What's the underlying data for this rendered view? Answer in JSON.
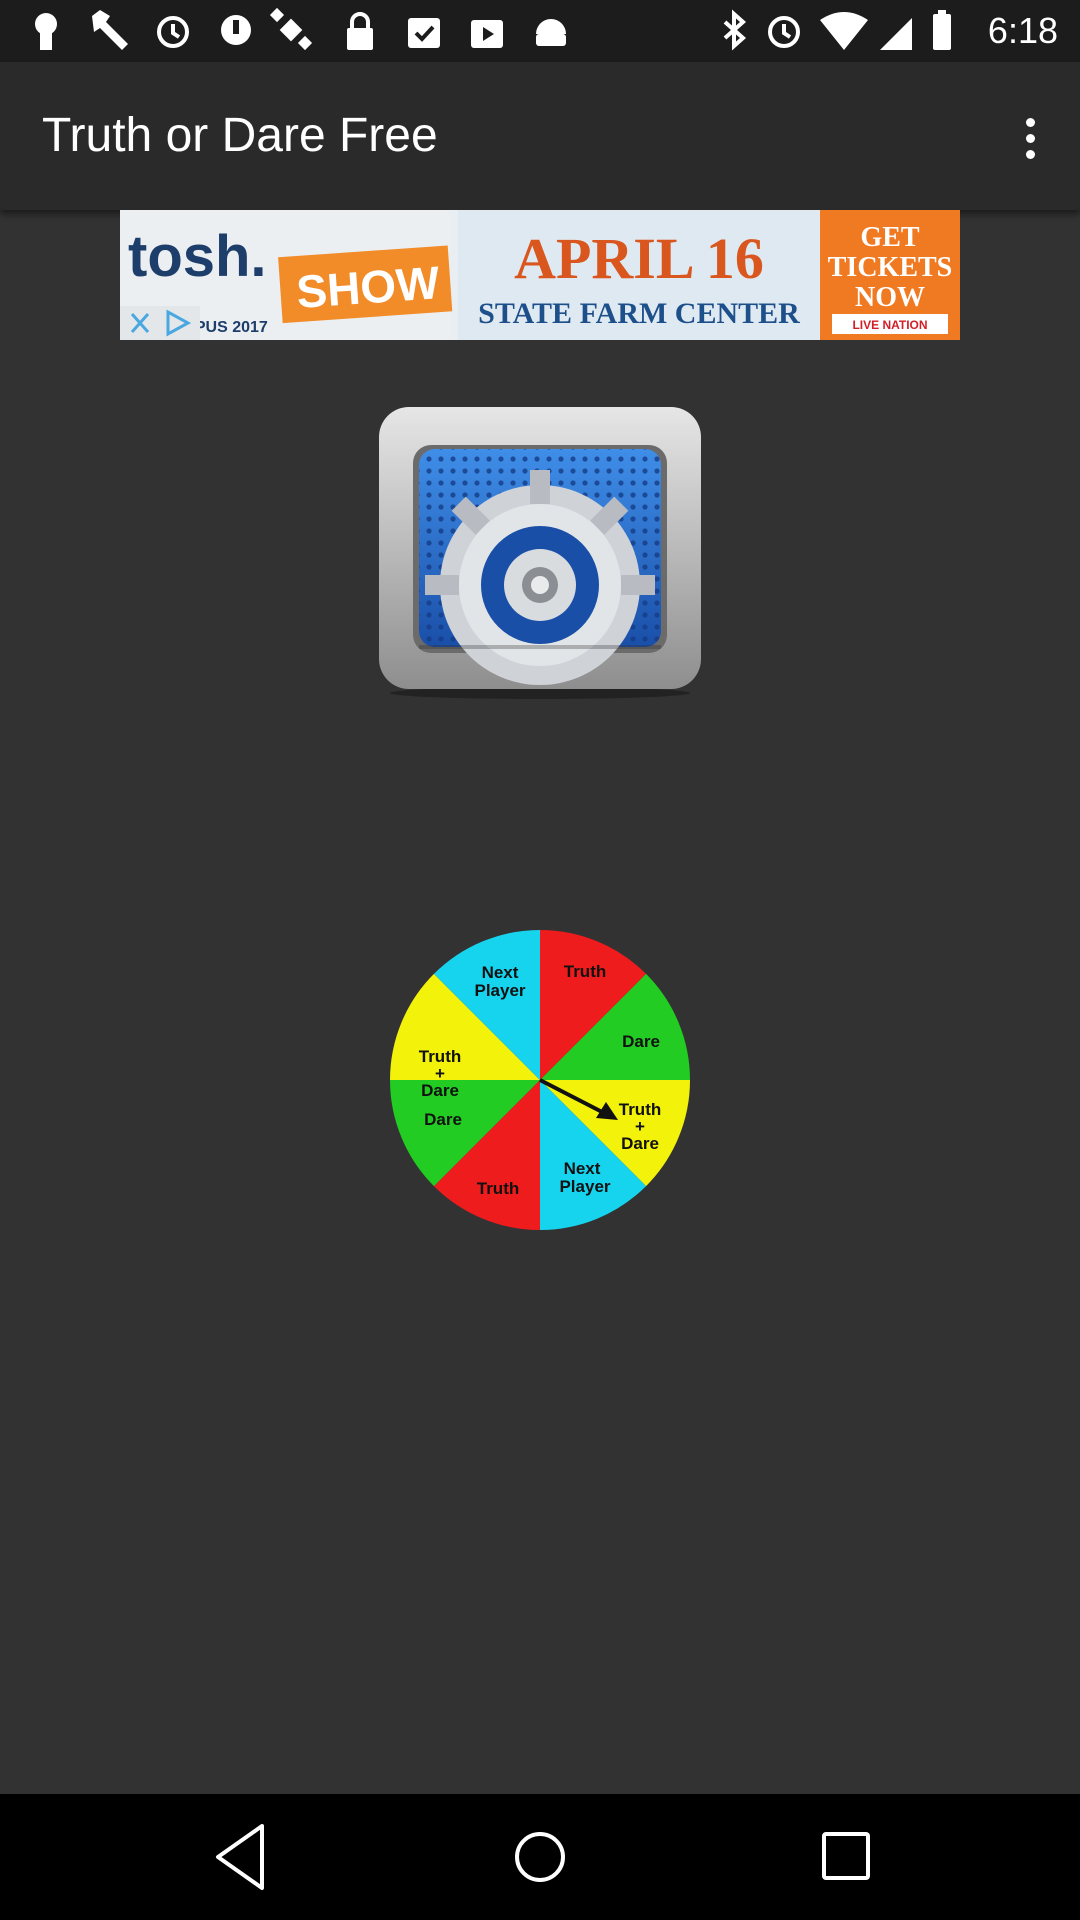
{
  "status_bar": {
    "time": "6:18",
    "left_icons": [
      "keyhole-icon",
      "wrench-icon",
      "alarm-icon",
      "alert-icon",
      "satellite-icon",
      "lock-icon",
      "clipboard-check-icon",
      "play-store-icon",
      "android-icon"
    ],
    "right_icons": [
      "bluetooth-icon",
      "alarm-icon",
      "wifi-icon",
      "signal-icon",
      "battery-icon"
    ]
  },
  "app_bar": {
    "title": "Truth or Dare Free",
    "menu_icon": "more-vert-icon"
  },
  "ad_banner": {
    "logo_text": "tosh.",
    "show_text": "SHOW",
    "small_text": "ON CAMPUS 2017",
    "date_text": "APRIL 16",
    "venue_text": "STATE FARM CENTER",
    "cta_line1": "GET",
    "cta_line2": "TICKETS",
    "cta_line3": "NOW",
    "sponsor_text": "LIVE NATION",
    "close_icon": "close-icon",
    "adchoices_icon": "adchoices-icon"
  },
  "settings_button": {
    "icon": "gear-settings-icon"
  },
  "spinner_wheel": {
    "labels": {
      "truth_top": "Truth",
      "dare_right": "Dare",
      "truth_dare_right_1": "Truth",
      "truth_dare_right_2": "+",
      "truth_dare_right_3": "Dare",
      "next_player_bottom_1": "Next",
      "next_player_bottom_2": "Player",
      "truth_bottom": "Truth",
      "dare_left": "Dare",
      "truth_dare_left_1": "Truth",
      "truth_dare_left_2": "+",
      "truth_dare_left_3": "Dare",
      "next_player_top_1": "Next",
      "next_player_top_2": "Player"
    },
    "colors": {
      "red": "#ee1c1c",
      "green": "#22cc22",
      "yellow": "#f2f20a",
      "cyan": "#17d4ee"
    },
    "pointer_icon": "arrow-pointer-icon"
  },
  "nav_bar": {
    "back_icon": "back-triangle-icon",
    "home_icon": "home-circle-icon",
    "recents_icon": "recents-square-icon"
  }
}
